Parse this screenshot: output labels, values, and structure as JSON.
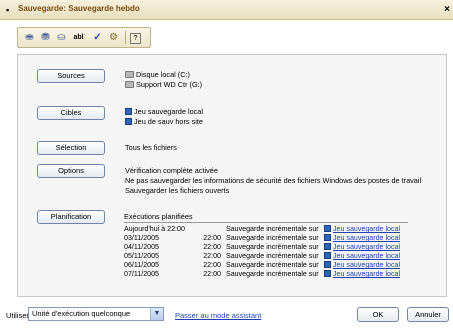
{
  "window": {
    "title": "Sauvegarde: Sauvegarde hebdo",
    "close_glyph": "×"
  },
  "toolbar": {
    "buttons": [
      {
        "icon": "backup-icon",
        "glyph": "⛂"
      },
      {
        "icon": "restore-icon",
        "glyph": "⛃"
      },
      {
        "icon": "copy-icon",
        "glyph": "⛀"
      },
      {
        "icon": "text-field-icon",
        "glyph": "abl"
      },
      {
        "icon": "check-icon",
        "glyph": "✓"
      },
      {
        "icon": "settings-icon",
        "glyph": "⚙"
      },
      {
        "icon": "help-icon",
        "glyph": "?"
      }
    ]
  },
  "sources": {
    "button_label": "Sources",
    "items": [
      "Disque local (C:)",
      "Support WD Ctr (G:)"
    ]
  },
  "cibles": {
    "button_label": "Cibles",
    "items": [
      "Jeu sauvegarde local",
      "Jeu de sauv hors site"
    ]
  },
  "selection": {
    "button_label": "Sélection",
    "text": "Tous les fichiers"
  },
  "options": {
    "button_label": "Options",
    "lines": [
      "Vérification complète activée",
      "Ne pas sauvegarder les informations de sécurité des fichiers Windows des postes de travail",
      "Sauvegarder les fichiers ouverts"
    ]
  },
  "planification": {
    "button_label": "Planification",
    "header": "Exécutions planifiées",
    "rows": [
      {
        "date": "Aujourd'hui à 22:00",
        "time": "",
        "type": "Sauvegarde incrémentale sur",
        "target": "Jeu sauvegarde local"
      },
      {
        "date": "03/11/2005",
        "time": "22:00",
        "type": "Sauvegarde incrémentale sur",
        "target": "Jeu sauvegarde local"
      },
      {
        "date": "04/11/2005",
        "time": "22:00",
        "type": "Sauvegarde incrémentale sur",
        "target": "Jeu sauvegarde local"
      },
      {
        "date": "05/11/2005",
        "time": "22:00",
        "type": "Sauvegarde incrémentale sur",
        "target": "Jeu sauvegarde local"
      },
      {
        "date": "06/11/2005",
        "time": "22:00",
        "type": "Sauvegarde incrémentale sur",
        "target": "Jeu sauvegarde local"
      },
      {
        "date": "07/11/2005",
        "time": "22:00",
        "type": "Sauvegarde incrémentale sur",
        "target": "Jeu sauvegarde local"
      }
    ]
  },
  "footer": {
    "use_label": "Utiliser",
    "executor_value": "Unité d'exécution quelconque",
    "assistant_link": "Passer au mode assistant",
    "ok_label": "OK",
    "cancel_label": "Annuler"
  },
  "colors": {
    "title_text": "#7a4a0e",
    "link": "#1d3fb0",
    "button_border": "#6f86a8"
  }
}
